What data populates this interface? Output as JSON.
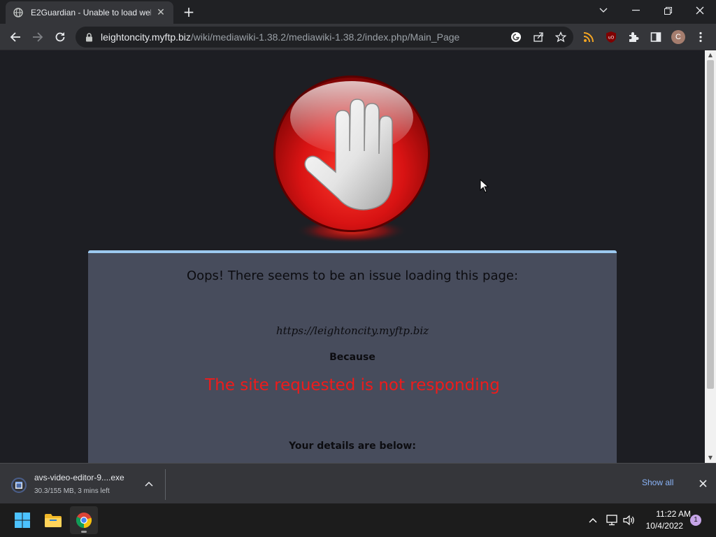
{
  "browser": {
    "tab": {
      "title": "E2Guardian - Unable to load web",
      "favicon": "globe-icon",
      "close_glyph": "✕"
    },
    "new_tab_glyph": "+",
    "window_controls": {
      "tab_search_glyph": "⌄",
      "minimize_glyph": "—",
      "restore_glyph": "❐",
      "close_glyph": "✕"
    },
    "toolbar": {
      "back": "arrow-left-icon",
      "forward": "arrow-right-icon",
      "reload": "reload-icon",
      "url_host": "leightoncity.myftp.biz",
      "url_path": "/wiki/mediawiki-1.38.2/mediawiki-1.38.2/index.php/Main_Page",
      "profile_initial": "C"
    }
  },
  "page": {
    "headline": "Oops! There seems to be an issue loading this page:",
    "blocked_url": "https://leightoncity.myftp.biz",
    "because_label": "Because",
    "reason": "The site requested is not responding",
    "details_label": "Your details are below:"
  },
  "download_shelf": {
    "file_name": "avs-video-editor-9....exe",
    "status": "30.3/155 MB, 3 mins left",
    "show_all": "Show all",
    "close_glyph": "✕"
  },
  "taskbar": {
    "time": "11:22 AM",
    "date": "10/4/2022",
    "notification_count": "1"
  },
  "colors": {
    "page_background": "#1d1e23",
    "panel_background": "#474c5c",
    "panel_top_border": "#9cc9f0",
    "reason_red": "#ef1b1b",
    "link_blue": "#8ab4f8"
  }
}
